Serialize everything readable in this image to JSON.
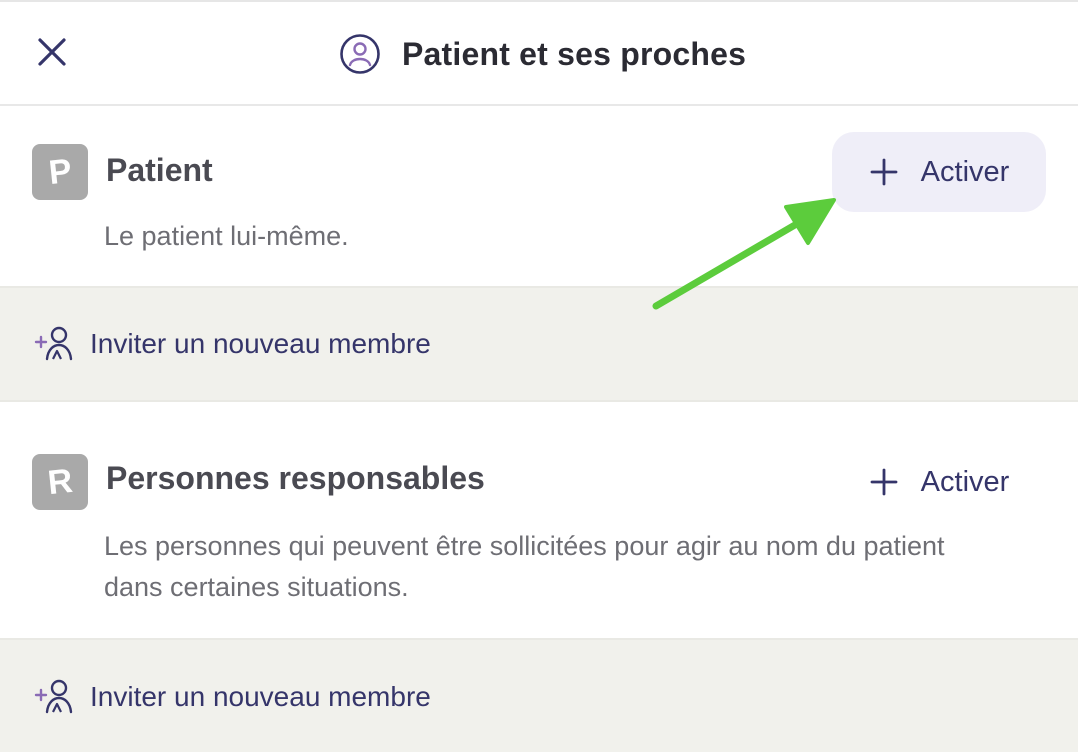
{
  "header": {
    "title": "Patient et ses proches",
    "close_icon": "close-icon",
    "title_icon": "user-circle-icon"
  },
  "sections": [
    {
      "badge": "P",
      "title": "Patient",
      "description": "Le patient lui-même.",
      "action_label": "Activer",
      "action_icon": "plus-icon",
      "highlighted": true
    },
    {
      "badge": "R",
      "title": "Personnes responsables",
      "description": "Les personnes qui peuvent être sollicitées pour agir au nom du patient dans certaines situations.",
      "action_label": "Activer",
      "action_icon": "plus-icon",
      "highlighted": false
    }
  ],
  "invite": {
    "label": "Inviter un nouveau membre",
    "icon": "add-person-icon"
  },
  "annotation": {
    "type": "arrow",
    "color": "#5ccc3c"
  },
  "colors": {
    "accent": "#35356a",
    "badge": "#a9a9a9",
    "invite_bg": "#f1f1ec",
    "highlight_bg": "#efeef8",
    "icon_purple": "#8a6bb5"
  }
}
